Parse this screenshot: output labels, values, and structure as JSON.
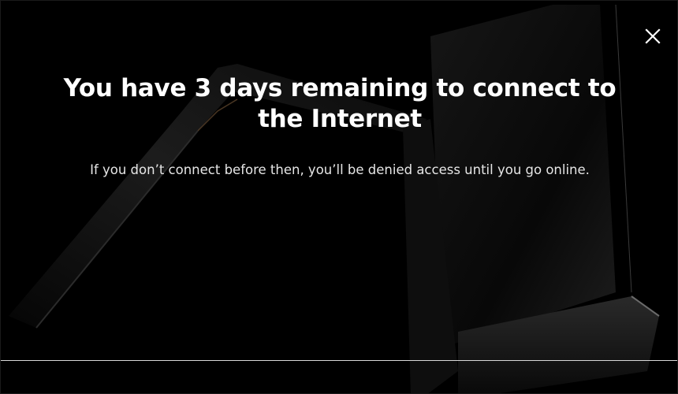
{
  "dialog": {
    "headline": "You have 3 days remaining to connect to the Internet",
    "message": "If you don’t connect before then, you’ll be denied access until you go online.",
    "close_icon": "close-icon"
  },
  "colors": {
    "background": "#000000",
    "text": "#ffffff",
    "divider": "#d9d9d9"
  }
}
